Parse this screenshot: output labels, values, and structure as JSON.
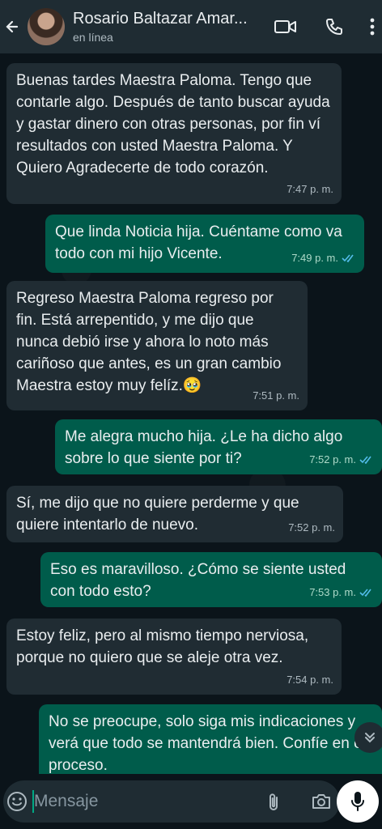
{
  "header": {
    "contact_name": "Rosario Baltazar Amar...",
    "status": "en línea"
  },
  "messages": [
    {
      "direction": "in",
      "text": "Buenas tardes Maestra Paloma. Tengo que contarle algo. Después de tanto buscar ayuda y gastar dinero con otras personas, por fin ví resultados con usted Maestra Paloma. Y Quiero Agradecerte de todo corazón.",
      "time": "7:47 p. m."
    },
    {
      "direction": "out",
      "text": "Que linda Noticia hija. Cuéntame como va todo con mi hijo Vicente.",
      "time": "7:49 p. m.",
      "read": true
    },
    {
      "direction": "in",
      "text": "Regreso Maestra Paloma regreso por fin. Está arrepentido, y me dijo que nunca debió irse y ahora lo noto más cariñoso que antes, es un gran cambio Maestra estoy muy felíz.",
      "emoji": "🥹",
      "time": "7:51 p. m."
    },
    {
      "direction": "out",
      "text": "Me alegra mucho hija. ¿Le ha dicho algo sobre lo que siente por ti?",
      "time": "7:52 p. m.",
      "read": true
    },
    {
      "direction": "in",
      "text": "Sí, me dijo que no quiere perderme y que quiere intentarlo de nuevo.",
      "time": "7:52 p. m."
    },
    {
      "direction": "out",
      "text": "Eso es maravilloso. ¿Cómo se siente usted con todo esto?",
      "time": "7:53 p. m.",
      "read": true
    },
    {
      "direction": "in",
      "text": "Estoy feliz, pero al mismo tiempo nerviosa, porque no quiero que se aleje otra vez.",
      "time": "7:54 p. m."
    },
    {
      "direction": "out",
      "text": "No se preocupe, solo siga mis indicaciones y verá que todo se mantendrá bien. Confíe en el proceso."
    }
  ],
  "composer": {
    "placeholder": "Mensaje"
  },
  "colors": {
    "header_bg": "#1f2c33",
    "incoming_bubble": "#202c33",
    "outgoing_bubble": "#005c4b",
    "read_tick": "#53bdeb",
    "accent": "#00a884"
  }
}
